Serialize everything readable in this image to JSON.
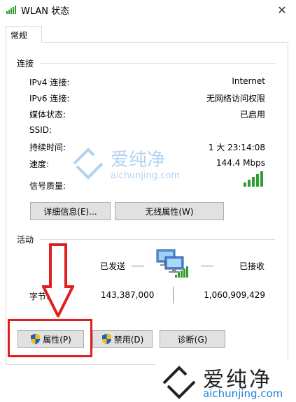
{
  "window": {
    "title": "WLAN 状态",
    "close_glyph": "✕"
  },
  "tabs": [
    {
      "label": "常规"
    }
  ],
  "connection": {
    "header": "连接",
    "rows": [
      {
        "label": "IPv4 连接:",
        "value": "Internet"
      },
      {
        "label": "IPv6 连接:",
        "value": "无网络访问权限"
      },
      {
        "label": "媒体状态:",
        "value": "已启用"
      },
      {
        "label": "SSID:",
        "value": ""
      },
      {
        "label": "持续时间:",
        "value": "1 大 23:14:08"
      },
      {
        "label": "速度:",
        "value": "144.4 Mbps"
      },
      {
        "label": "信号质量:",
        "value": ""
      }
    ],
    "signal_level": 5,
    "buttons": {
      "details": "详细信息(E)...",
      "wireless_props": "无线属性(W)"
    }
  },
  "activity": {
    "header": "活动",
    "sent_label": "已发送",
    "received_label": "已接收",
    "bytes_label": "字节:",
    "bytes_sent": "143,387,000",
    "bytes_received": "1,060,909,429"
  },
  "bottom_buttons": {
    "properties": "属性(P)",
    "disable": "禁用(D)",
    "diagnose": "诊断(G)"
  },
  "watermark": {
    "center_cn": "爱纯净",
    "center_url": "aichunjing.com",
    "bottom_cn": "爱纯净",
    "bottom_url": "aichunjing.com"
  },
  "colors": {
    "signal_green": "#2e9e2e",
    "annotation_red": "#e02020",
    "button_face": "#e1e1e1",
    "watermark_blue": "#1f7fd8"
  }
}
